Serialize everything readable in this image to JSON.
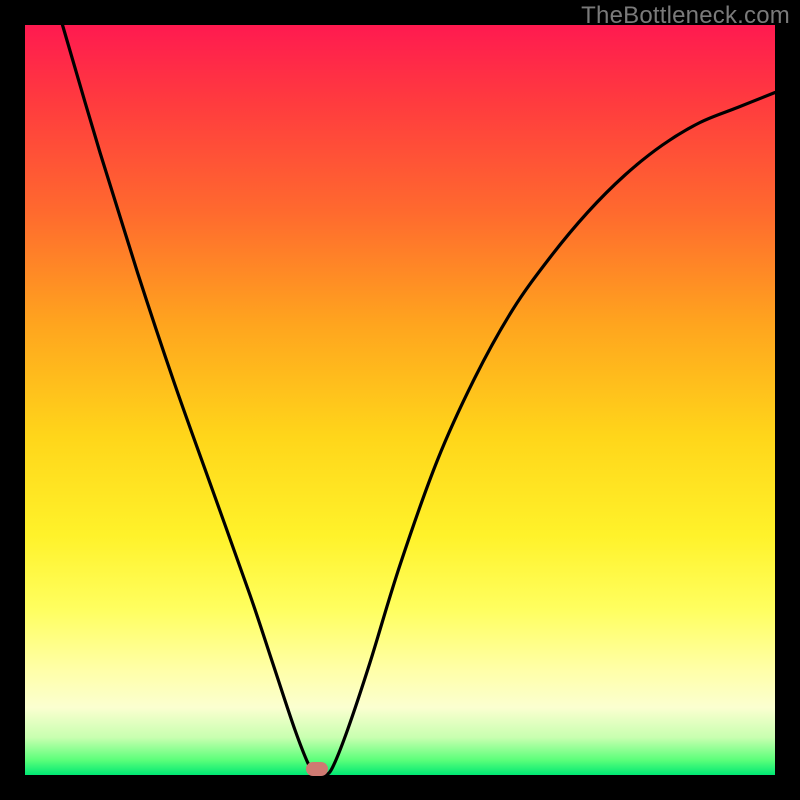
{
  "watermark": "TheBottleneck.com",
  "marker": {
    "x_pct": 38.9,
    "y_pct": 99.2
  },
  "chart_data": {
    "type": "line",
    "title": "",
    "xlabel": "",
    "ylabel": "",
    "xlim": [
      0,
      100
    ],
    "ylim": [
      0,
      100
    ],
    "grid": false,
    "legend": false,
    "annotations": [
      {
        "text": "TheBottleneck.com",
        "position": "top-right"
      }
    ],
    "series": [
      {
        "name": "bottleneck-curve",
        "x": [
          5,
          10,
          15,
          20,
          25,
          30,
          33,
          36,
          38,
          39,
          40,
          41,
          43,
          46,
          50,
          55,
          60,
          65,
          70,
          75,
          80,
          85,
          90,
          95,
          100
        ],
        "y": [
          100,
          83,
          67,
          52,
          38,
          24,
          15,
          6,
          1,
          0,
          0,
          1,
          6,
          15,
          28,
          42,
          53,
          62,
          69,
          75,
          80,
          84,
          87,
          89,
          91
        ]
      }
    ],
    "notes": "V-shaped bottleneck curve with minimum near x≈39%. Background is a vertical gradient from red (high bottleneck) at top through orange/yellow to green (no bottleneck) at bottom. A small rounded marker sits at the curve minimum on the green band."
  }
}
